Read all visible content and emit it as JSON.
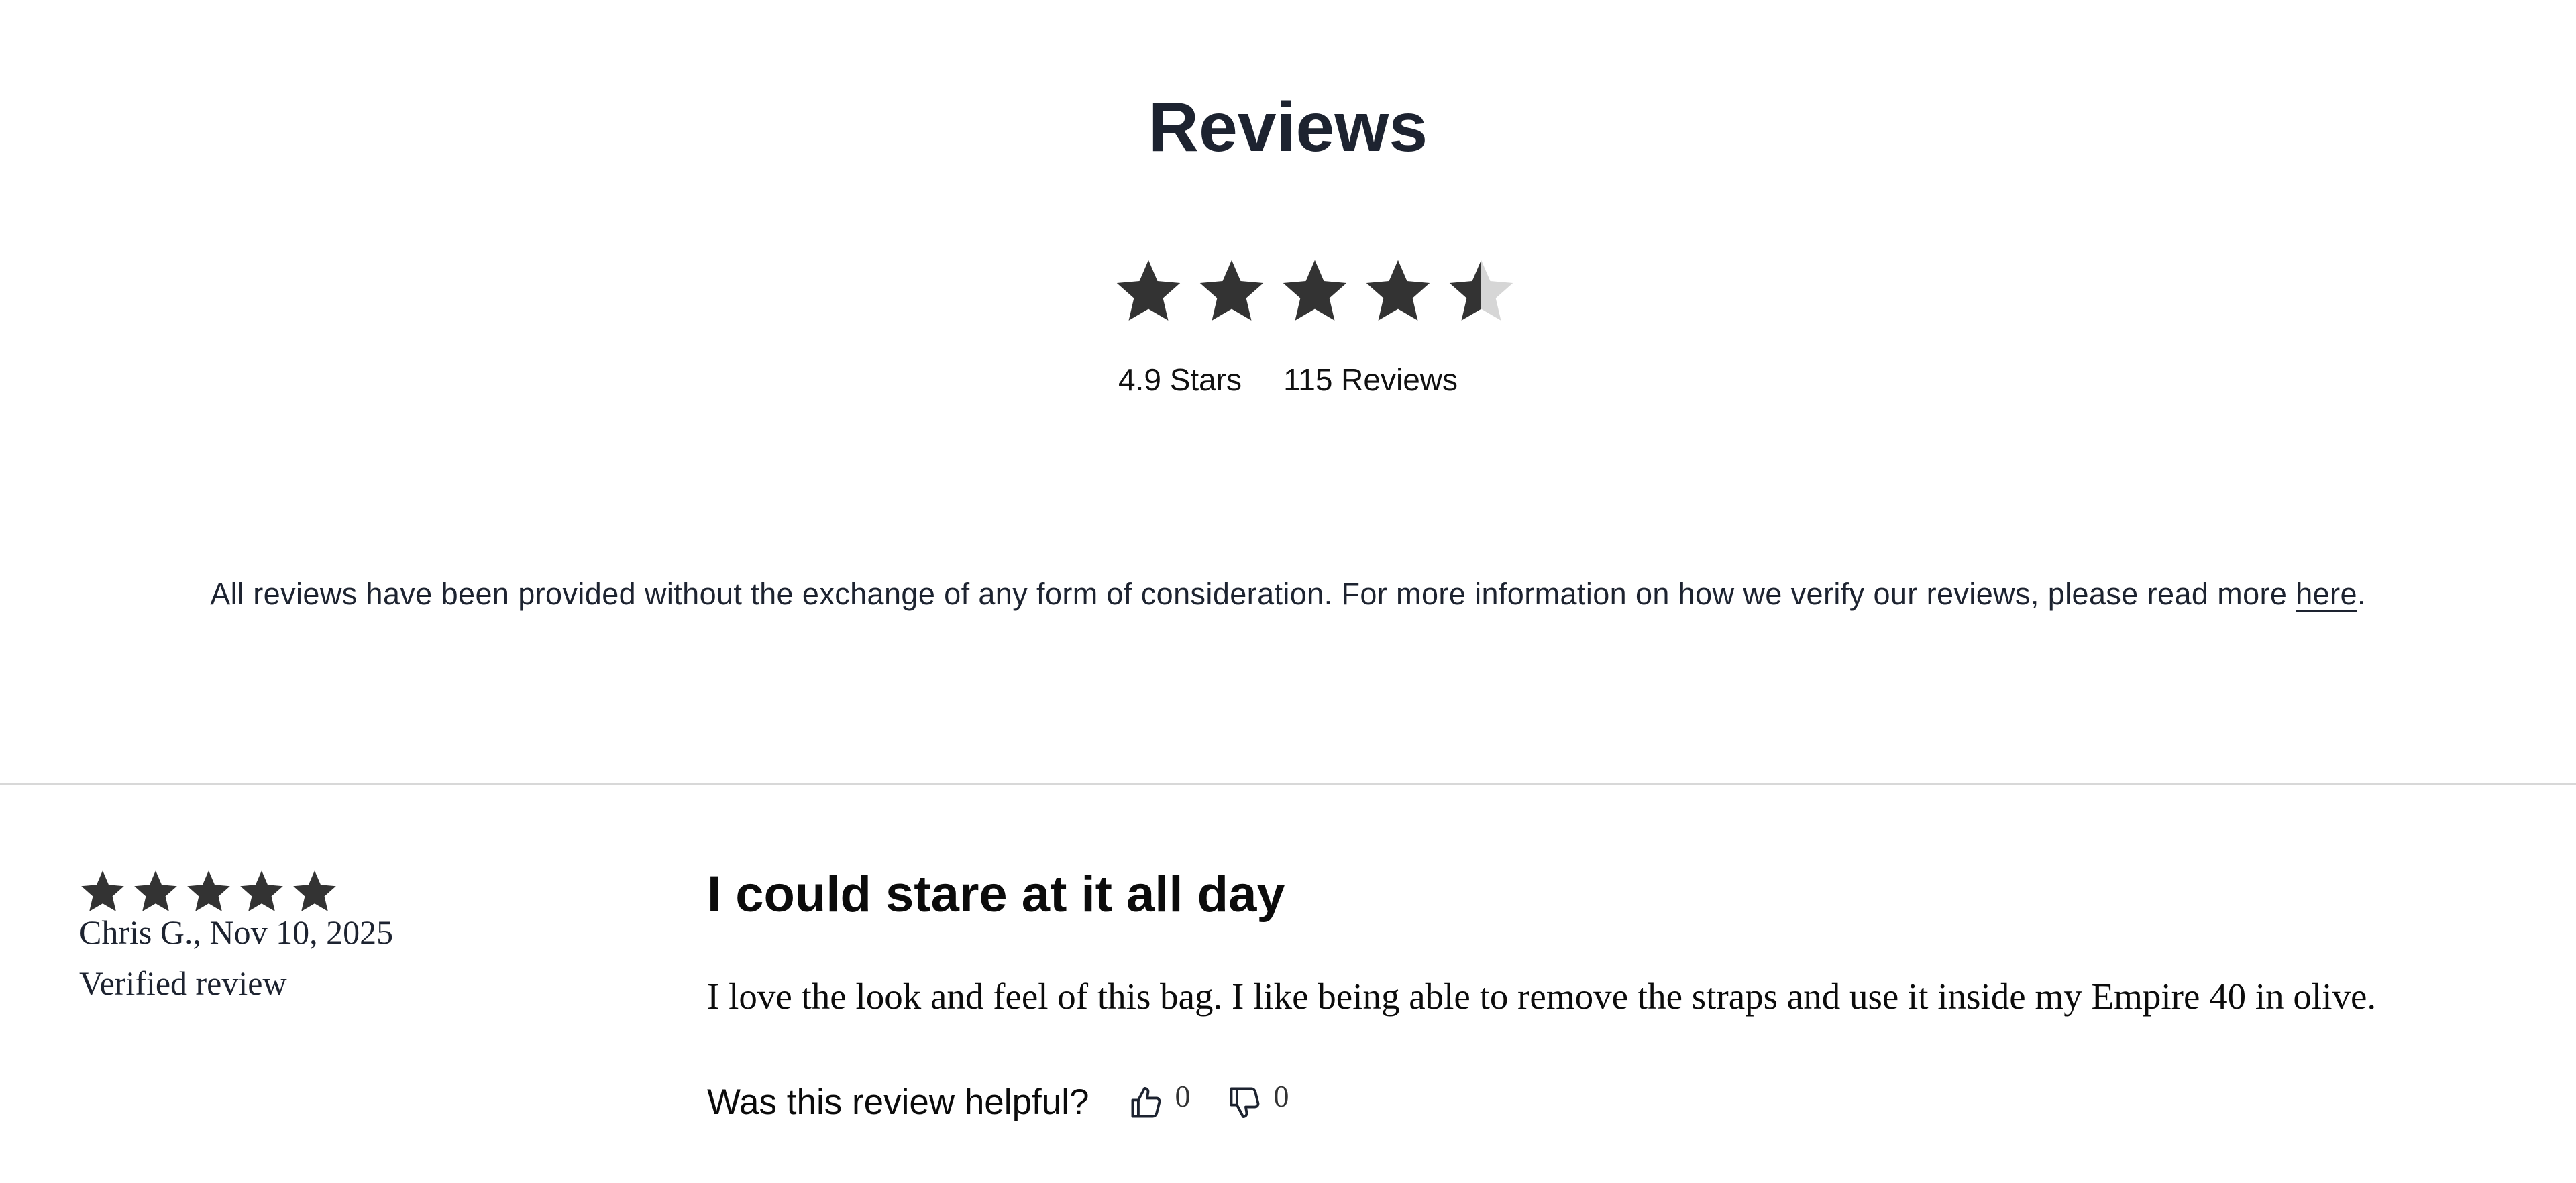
{
  "summary": {
    "heading": "Reviews",
    "rating": 4.9,
    "rating_max": 5,
    "rating_label": "4.9 Stars",
    "review_count_label": "115 Reviews",
    "star_fill_color": "#333333",
    "star_empty_color": "#d6d6d6"
  },
  "disclaimer": {
    "text": "All reviews have been provided without the exchange of any form of consideration. For more information on how we verify our reviews, please read more ",
    "link_text": "here",
    "trailing": "."
  },
  "reviews": [
    {
      "rating": 5,
      "author_date": "Chris G., Nov 10, 2025",
      "verified_label": "Verified review",
      "title": "I could stare at it all day",
      "body": "I love the look and feel of this bag. I like being able to remove the straps and use it inside my Empire 40 in olive.",
      "helpful_prompt": "Was this review helpful?",
      "thumbs_up_icon": "thumbs-up-icon",
      "thumbs_down_icon": "thumbs-down-icon",
      "helpful_yes_count": "0",
      "helpful_no_count": "0"
    }
  ]
}
